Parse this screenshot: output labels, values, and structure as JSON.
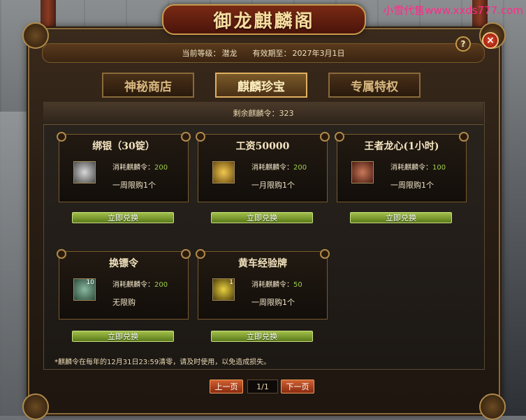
{
  "watermark": "小雪代售www.xxds777.com",
  "title": "御龙麒麟阁",
  "status": {
    "level_label": "当前等级：",
    "level_value": "潜龙",
    "expiry_label": "有效期至：",
    "expiry_value": "2027年3月1日"
  },
  "help_label": "?",
  "close_label": "×",
  "tabs": [
    {
      "label": "神秘商店",
      "active": false
    },
    {
      "label": "麒麟珍宝",
      "active": true
    },
    {
      "label": "专属特权",
      "active": false
    }
  ],
  "remaining": {
    "label": "剩余麒麟令：",
    "value": "323"
  },
  "cost_label": "消耗麒麟令：",
  "items": [
    {
      "name": "绑银（30锭）",
      "cost": "200",
      "limit": "一周限购1个",
      "icon": "silver-ingot-icon",
      "count": ""
    },
    {
      "name": "工资50000",
      "cost": "200",
      "limit": "一月限购1个",
      "icon": "gold-pouch-icon",
      "count": ""
    },
    {
      "name": "王者龙心(1小时)",
      "cost": "100",
      "limit": "一周限购1个",
      "icon": "dragon-heart-icon",
      "count": ""
    },
    {
      "name": "换镖令",
      "cost": "200",
      "limit": "无限购",
      "icon": "escort-token-icon",
      "count": "10"
    },
    {
      "name": "黄车经验牌",
      "cost": "50",
      "limit": "一周限购1个",
      "icon": "yellow-cart-icon",
      "count": "1"
    }
  ],
  "exchange_label": "立即兑换",
  "notice": "*麒麟令在每年的12月31日23:59清零，请及时使用，以免造成损失。",
  "pager": {
    "prev": "上一页",
    "page": "1/1",
    "next": "下一页"
  },
  "colors": {
    "accent_gold": "#c89a4a",
    "button_green": "#7a9a2a",
    "cost_green": "#9ed048",
    "pager_red": "#b04420"
  }
}
